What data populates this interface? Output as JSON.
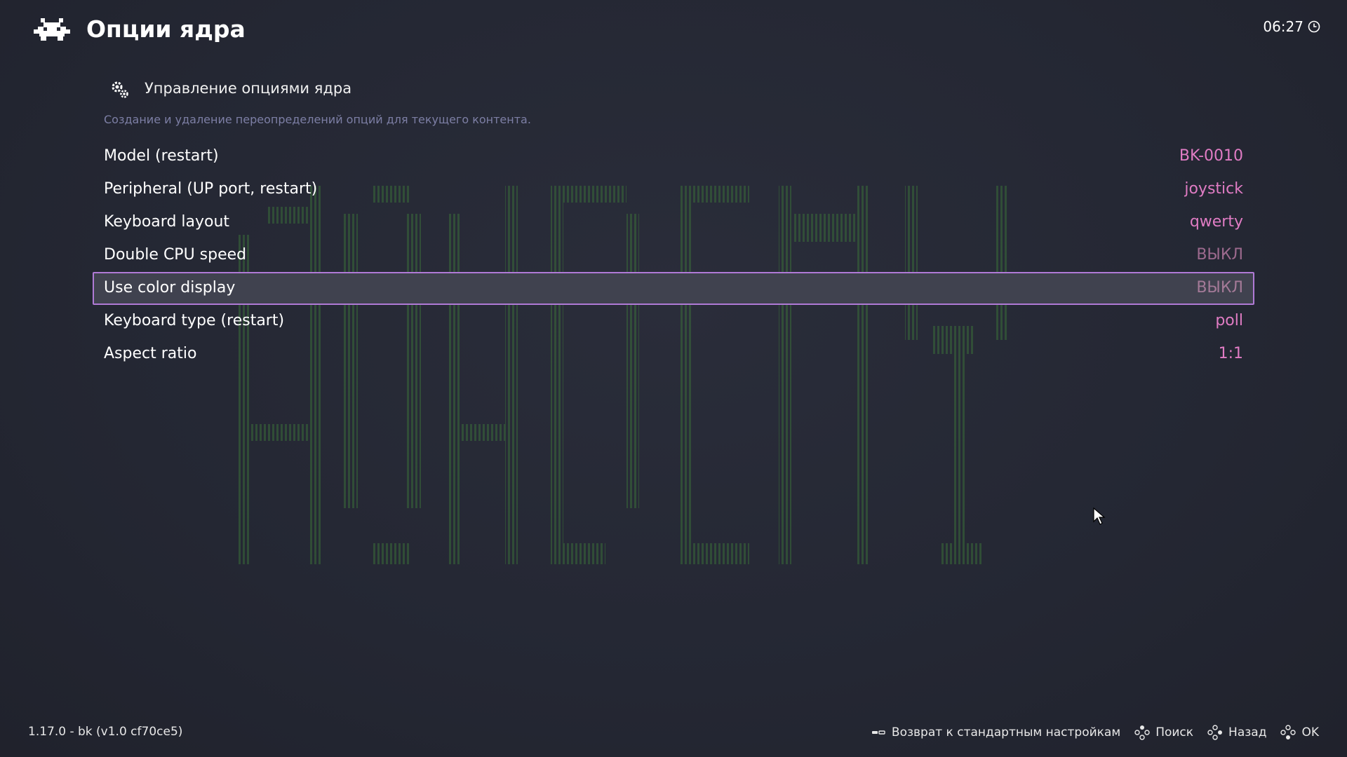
{
  "header": {
    "title": "Опции ядра",
    "clock": "06:27",
    "logo_icon": "retroarch-invader-icon",
    "clock_icon": "clock-icon"
  },
  "section": {
    "icon": "gears-icon",
    "label": "Управление опциями ядра",
    "sublabel": "Создание и удаление переопределений опций для текущего контента."
  },
  "options": [
    {
      "label": "Model (restart)",
      "value": "BK-0010",
      "off": false,
      "selected": false
    },
    {
      "label": "Peripheral (UP port, restart)",
      "value": "joystick",
      "off": false,
      "selected": false
    },
    {
      "label": "Keyboard layout",
      "value": "qwerty",
      "off": false,
      "selected": false
    },
    {
      "label": "Double CPU speed",
      "value": "ВЫКЛ",
      "off": true,
      "selected": false
    },
    {
      "label": "Use color display",
      "value": "ВЫКЛ",
      "off": true,
      "selected": true
    },
    {
      "label": "Keyboard type (restart)",
      "value": "poll",
      "off": false,
      "selected": false
    },
    {
      "label": "Aspect ratio",
      "value": "1:1",
      "off": false,
      "selected": false
    }
  ],
  "footer": {
    "version": "1.17.0 - bk (v1.0 cf70ce5)",
    "hints": [
      {
        "icon": "select-key-icon",
        "label": "Возврат к стандартным настройкам"
      },
      {
        "icon": "gamepad-y-icon",
        "label": "Поиск"
      },
      {
        "icon": "gamepad-b-icon",
        "label": "Назад"
      },
      {
        "icon": "gamepad-a-icon",
        "label": "OK"
      }
    ]
  },
  "colors": {
    "background": "#252834",
    "accent_border": "#b07ad6",
    "value_pink": "#e07cc4",
    "value_off": "#9c6a8e",
    "sublabel": "#7d7fa5",
    "bg_art_green": "#3e7a3a"
  }
}
